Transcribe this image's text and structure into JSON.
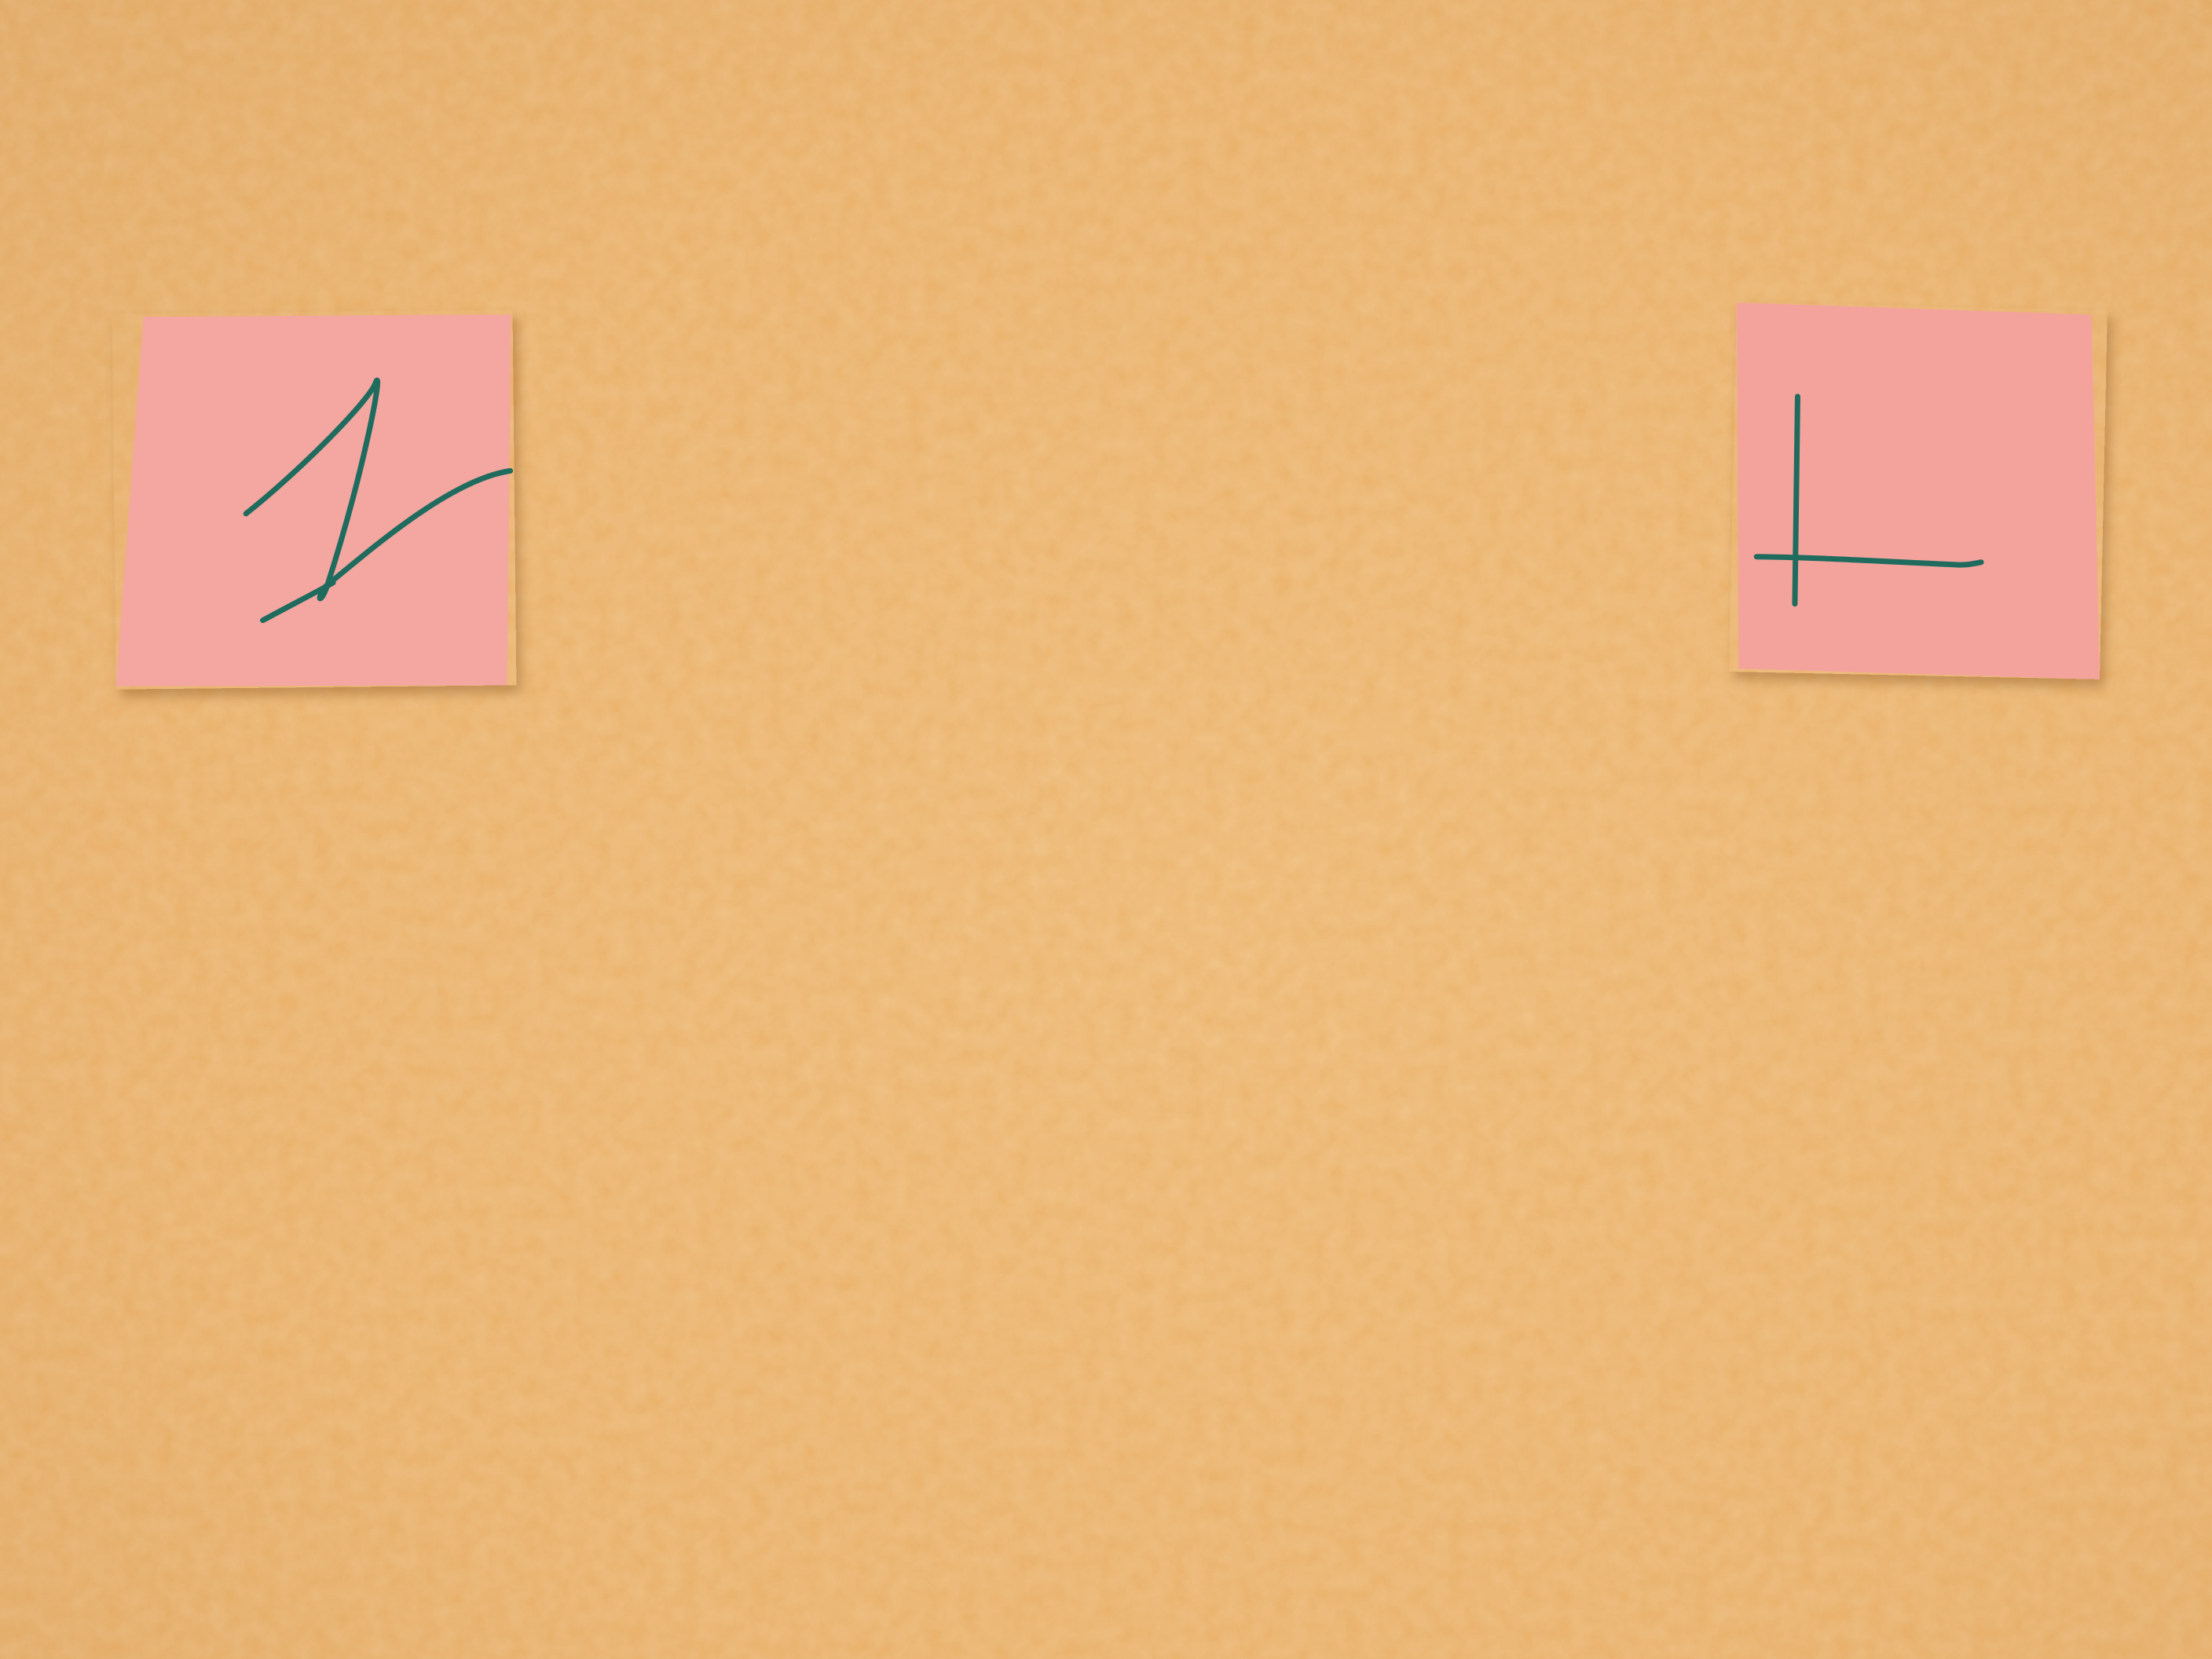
{
  "scene": {
    "subject": "wall-with-two-sticky-notes",
    "colors": {
      "wall": "#e9b068",
      "wall_light": "#f2c07a",
      "wall_shadow": "#d39a55",
      "note_left": "#f4a6a0",
      "note_right": "#f4a39c",
      "marker_ink": "#1f6b5e"
    },
    "notes": [
      {
        "id": "left",
        "mark": "handwritten-scribble-glyph"
      },
      {
        "id": "right",
        "mark": "handwritten-axes-glyph"
      }
    ]
  }
}
